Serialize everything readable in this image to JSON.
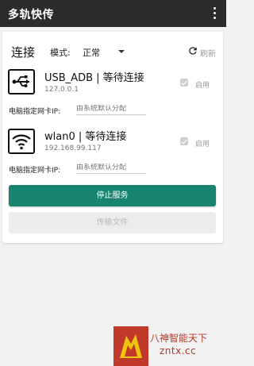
{
  "appbar": {
    "title": "多轨快传",
    "menu_icon": "more-vertical-icon"
  },
  "connection": {
    "label": "连接",
    "mode_label": "模式:",
    "mode_value": "正常",
    "refresh_label": "刷新",
    "refresh_icon": "refresh-icon"
  },
  "devices": [
    {
      "icon": "usb-icon",
      "name": "USB_ADB | 等待连接",
      "address": "127.0.0.1",
      "enable_label": "启用",
      "enabled": true,
      "ip_label": "电脑指定网卡IP:",
      "ip_placeholder": "由系统默认分配"
    },
    {
      "icon": "wifi-icon",
      "name": "wlan0 | 等待连接",
      "address": "192.168.99.117",
      "enable_label": "启用",
      "enabled": true,
      "ip_label": "电脑指定网卡IP:",
      "ip_placeholder": "由系统默认分配"
    }
  ],
  "actions": {
    "stop_label": "停止服务",
    "send_label": "传输文件"
  },
  "watermark": {
    "line1": "八神智能天下",
    "line2": "zntx.cc"
  },
  "colors": {
    "appbar": "#2b2b2b",
    "primary": "#17856f",
    "disabled": "#ececec",
    "watermark": "#b23a2a"
  }
}
